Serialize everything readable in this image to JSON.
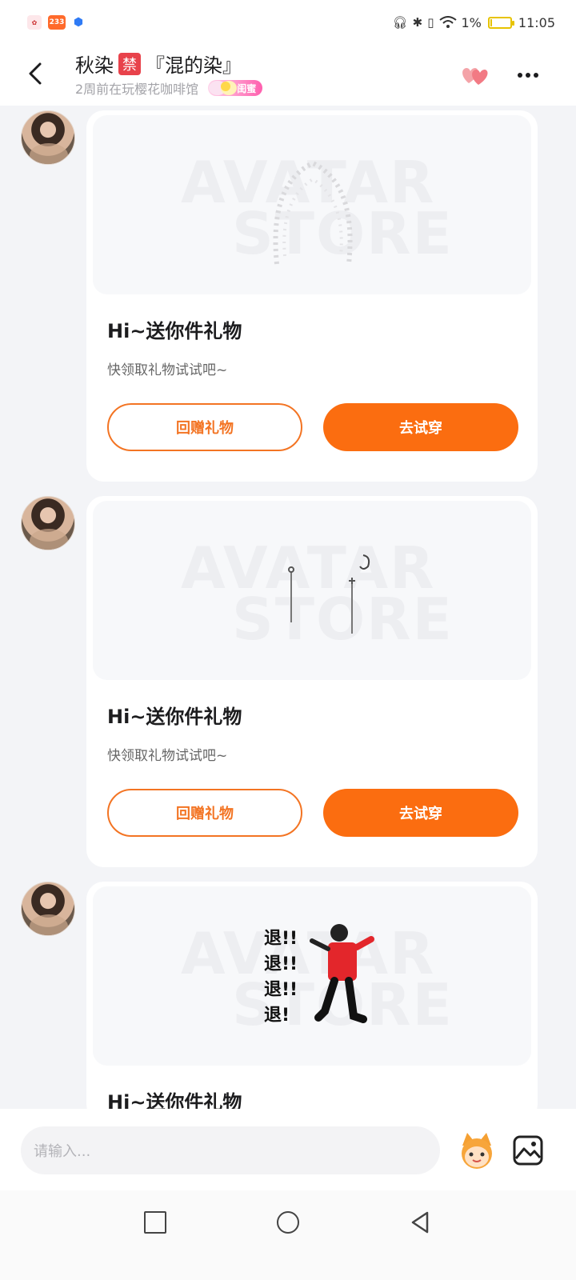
{
  "status_bar": {
    "app_icon_233": "233",
    "battery_percent": "1%",
    "time": "11:05",
    "battery_level": 0.01
  },
  "header": {
    "name": "秋染",
    "ban_badge": "禁",
    "nickname": "『混的染』",
    "subtitle": "2周前在玩樱花咖啡馆",
    "bestie_badge": "闺蜜"
  },
  "messages": [
    {
      "watermark_line1": "AVATAR",
      "watermark_line2": "STORE",
      "title": "Hi~送你件礼物",
      "desc": "快领取礼物试试吧~",
      "return_label": "回赠礼物",
      "try_label": "去试穿"
    },
    {
      "watermark_line1": "AVATAR",
      "watermark_line2": "STORE",
      "title": "Hi~送你件礼物",
      "desc": "快领取礼物试试吧~",
      "return_label": "回赠礼物",
      "try_label": "去试穿"
    },
    {
      "watermark_line1": "AVATAR",
      "watermark_line2": "STORE",
      "sticker_text": "退!! 退!! 退!! 退!",
      "title": "Hi~送你件礼物"
    }
  ],
  "input": {
    "placeholder": "请输入..."
  },
  "colors": {
    "accent_orange": "#fb6d10",
    "ban_red": "#e8424b",
    "background": "#f3f4f7"
  }
}
